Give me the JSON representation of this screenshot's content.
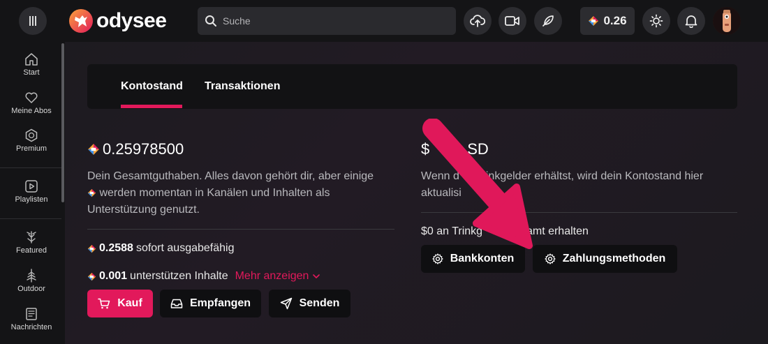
{
  "header": {
    "logo_text": "odysee",
    "search_placeholder": "Suche",
    "balance": "0.26"
  },
  "sidebar": {
    "items": [
      {
        "label": "Start",
        "icon": "home-icon"
      },
      {
        "label": "Meine Abos",
        "icon": "heart-icon"
      },
      {
        "label": "Premium",
        "icon": "premium-icon"
      },
      {
        "label": "Playlisten",
        "icon": "playlist-icon"
      },
      {
        "label": "Featured",
        "icon": "featured-icon"
      },
      {
        "label": "Outdoor",
        "icon": "tree-icon"
      },
      {
        "label": "Nachrichten",
        "icon": "news-icon"
      }
    ]
  },
  "tabs": [
    {
      "label": "Kontostand",
      "active": true
    },
    {
      "label": "Transaktionen",
      "active": false
    }
  ],
  "wallet": {
    "total": "0.25978500",
    "description_1": "Dein Gesamtguthaben. Alles davon gehört dir, aber einige",
    "description_2": "werden momentan in Kanälen und Inhalten als",
    "description_3": "Unterstützung genutzt.",
    "spendable_amount": "0.2588",
    "spendable_text": "sofort ausgabefähig",
    "supports_amount": "0.001",
    "supports_text": "unterstützen Inhalte",
    "more_link": "Mehr anzeigen",
    "buttons": {
      "buy": "Kauf",
      "receive": "Empfangen",
      "send": "Senden"
    }
  },
  "usd": {
    "amount_prefix": "$",
    "amount_suffix": "SD",
    "desc_1a": "Wenn d",
    "desc_1b": "inkgelder erhältst, wird dein Kontostand hier",
    "desc_2": "aktualisi",
    "tips_a": "$0 an Trinkg",
    "tips_b": "esamt erhalten",
    "buttons": {
      "bank": "Bankkonten",
      "payment": "Zahlungsmethoden"
    }
  },
  "colors": {
    "accent": "#e2195b",
    "arrow": "#e0185a"
  }
}
